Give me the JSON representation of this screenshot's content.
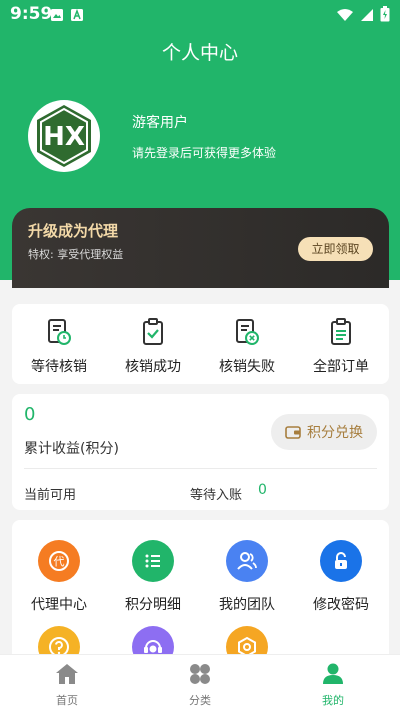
{
  "status_bar": {
    "time": "9:59"
  },
  "header": {
    "title": "个人中心"
  },
  "profile": {
    "logo_text": "HX",
    "name": "游客用户",
    "hint": "请先登录后可获得更多体验"
  },
  "vip": {
    "title": "升级成为代理",
    "desc": "特权: 享受代理权益",
    "button": "立即领取"
  },
  "orders": [
    {
      "label": "等待核销",
      "icon": "clock-doc-icon"
    },
    {
      "label": "核销成功",
      "icon": "check-clipboard-icon"
    },
    {
      "label": "核销失败",
      "icon": "x-doc-icon"
    },
    {
      "label": "全部订单",
      "icon": "list-clipboard-icon"
    }
  ],
  "earnings": {
    "total": "0",
    "total_label": "累计收益(积分)",
    "redeem_button": "积分兑换",
    "available_label": "当前可用",
    "pending_label": "等待入账",
    "pending_value": "0"
  },
  "tools": [
    {
      "label": "代理中心",
      "icon": "agent-icon",
      "color": "#f57c22"
    },
    {
      "label": "积分明细",
      "icon": "list-icon",
      "color": "#21b56a"
    },
    {
      "label": "我的团队",
      "icon": "team-icon",
      "color": "#4a82f2"
    },
    {
      "label": "修改密码",
      "icon": "lock-icon",
      "color": "#1a73e8"
    },
    {
      "label": "",
      "icon": "help-icon",
      "color": "#f5b225"
    },
    {
      "label": "",
      "icon": "service-icon",
      "color": "#8d6ef2"
    },
    {
      "label": "",
      "icon": "settings-icon",
      "color": "#f5a623"
    }
  ],
  "tabbar": [
    {
      "label": "首页",
      "icon": "home-icon"
    },
    {
      "label": "分类",
      "icon": "category-icon"
    },
    {
      "label": "我的",
      "icon": "user-icon"
    }
  ],
  "colors": {
    "primary": "#21b56a",
    "vip_bg": "#2f2c2a",
    "vip_text": "#f3d9a8",
    "redeem_text": "#a77e3e"
  }
}
